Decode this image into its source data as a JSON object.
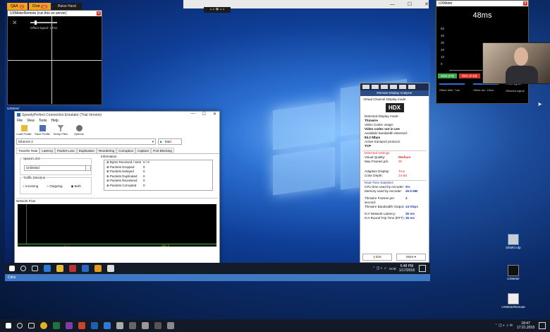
{
  "top_tabs": [
    {
      "label": "Q&A",
      "badge": "0"
    },
    {
      "label": "Chat",
      "badge": "36"
    },
    {
      "label": "Raise Hand",
      "badge": ""
    }
  ],
  "uxmeter_remote": {
    "title": "UXMeterRemote (run this on server)",
    "offset_label": "Offset signal: 17ms"
  },
  "uxmeter": {
    "title": "UXMeter",
    "latency": "48ms",
    "y_ticks": [
      "50",
      "40",
      "30",
      "20",
      "10",
      "0"
    ],
    "buttons": [
      "Start (F9)",
      "REC (F10)",
      "Magnet"
    ],
    "offset_filter": "Offset filter: 7ms",
    "offset_rec": "Offset rec: 15ms",
    "legend": [
      "Fetch signal",
      "Offseted signal"
    ]
  },
  "speedy": {
    "title": "SpeedyPerfect Connection Emulator (Trial Version)",
    "menu": [
      "File",
      "View",
      "Tools",
      "Help"
    ],
    "toolbar": [
      "Load Profile",
      "Save Profile",
      "Setup Filter",
      "Options"
    ],
    "adapter": "Ethernet 2",
    "start": "Start",
    "tabs": [
      "Transfer Rate",
      "Latency",
      "Packet Loss",
      "Duplication",
      "Reordering",
      "Corruption",
      "Capture",
      "Port Blocking"
    ],
    "speed_limit": "Speed Limit",
    "speed_value": "Unlimited",
    "traffic_direction": "Traffic Direction",
    "radios": [
      "Incoming",
      "Outgoing",
      "Both"
    ],
    "information": "Information",
    "info_rows": [
      {
        "k": "Bytes Received / Sent",
        "v": "0 / 0"
      },
      {
        "k": "Packets Dropped",
        "v": "0"
      },
      {
        "k": "Packets Delayed",
        "v": "0"
      },
      {
        "k": "Packets Duplicated",
        "v": "0"
      },
      {
        "k": "Packets Reordered",
        "v": "0"
      },
      {
        "k": "Packets Corrupted",
        "v": "0"
      }
    ],
    "network_flow": "Network Flow",
    "in_label": "In: 0",
    "out_label": "Out: 0"
  },
  "rda": {
    "title": "Remote Display Analyzer",
    "mode_label": "Virtual Channel Display mode",
    "hdx": "HDX",
    "rows": [
      {
        "k": "Detected Display mode:",
        "v": ""
      },
      {
        "k": "Thinwire",
        "v": ""
      },
      {
        "k": "Video Codec usage:",
        "v": ""
      },
      {
        "k": "Video codec not in use",
        "v": ""
      },
      {
        "k": "Available bandwidth detected:",
        "v": ""
      },
      {
        "k": "84.2 Mbps",
        "v": ""
      },
      {
        "k": "Active transport protocol:",
        "v": ""
      },
      {
        "k": "TCP",
        "v": ""
      }
    ],
    "detected_settings": "Detected settings",
    "settings": [
      {
        "k": "Visual Quality:",
        "v": "Medium"
      },
      {
        "k": "Max Frames p/s:",
        "v": "30"
      },
      {
        "k": "Adaptive Display:",
        "v": "True"
      },
      {
        "k": "Color Depth:",
        "v": "24-Bit"
      }
    ],
    "rt_title": "Real-Time Statistics",
    "stats": [
      {
        "k": "CPU time used by encoder:",
        "v": "0%"
      },
      {
        "k": "Memory used by encoder:",
        "v": "45.9 MB"
      },
      {
        "k": "Thinwire Frames per second:",
        "v": "4"
      },
      {
        "k": "Thinwire Bandwidth Output:",
        "v": "24 Kbps"
      },
      {
        "k": "ICA Network Latency:",
        "v": "35 ms"
      },
      {
        "k": "ICA Round Trip Time (RTT):",
        "v": "36 ms"
      }
    ],
    "exit": "Exit",
    "more": "More"
  },
  "inner_clock": {
    "time": "5:48 PM",
    "date": "1/17/2018",
    "lang": "NOB"
  },
  "remote_strip": "Citrix",
  "desktop_icons": [
    "DEMO.rdp",
    "UXMeter",
    "UXMeterRemote"
  ],
  "outer_clock": {
    "time": "18:47",
    "date": "17.01.2018"
  },
  "inner_left_label": "UXMeter"
}
